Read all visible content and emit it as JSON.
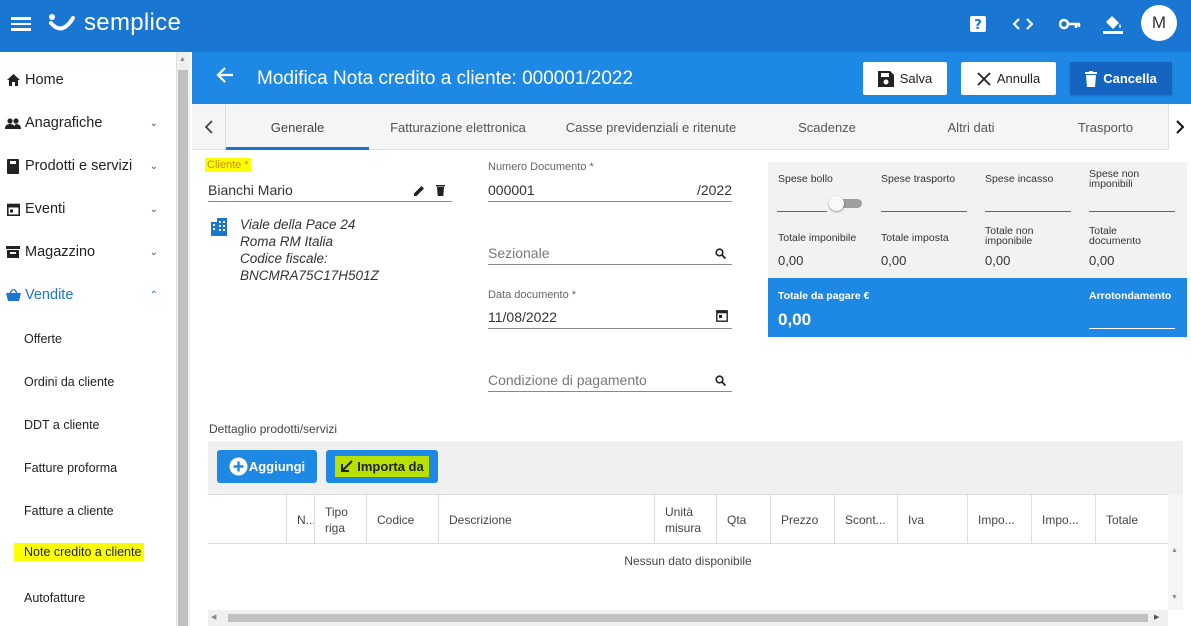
{
  "app": {
    "logo_text": "semplice",
    "avatar_initial": "M"
  },
  "topbar": {
    "icons": [
      "help-icon",
      "code-icon",
      "key-icon",
      "paint-bucket-icon"
    ]
  },
  "sidebar": {
    "items": [
      {
        "label": "Home",
        "icon": "home-icon"
      },
      {
        "label": "Anagrafiche",
        "icon": "people-icon"
      },
      {
        "label": "Prodotti e servizi",
        "icon": "book-icon"
      },
      {
        "label": "Eventi",
        "icon": "calendar-icon"
      },
      {
        "label": "Magazzino",
        "icon": "warehouse-icon"
      },
      {
        "label": "Vendite",
        "icon": "basket-icon"
      }
    ],
    "sub_items": [
      "Offerte",
      "Ordini da cliente",
      "DDT a cliente",
      "Fatture proforma",
      "Fatture a cliente",
      "Note credito a cliente",
      "Autofatture"
    ]
  },
  "header": {
    "title": "Modifica Nota credito a cliente: 000001/2022",
    "save_label": "Salva",
    "cancel_label": "Annulla",
    "delete_label": "Cancella"
  },
  "tabs": [
    "Generale",
    "Fatturazione elettronica",
    "Casse previdenziali e ritenute",
    "Scadenze",
    "Altri dati",
    "Trasporto"
  ],
  "form": {
    "cliente_label": "Cliente *",
    "cliente_value": "Bianchi Mario",
    "address_line1": "Viale della Pace 24",
    "address_line2": "Roma RM Italia",
    "address_line3": "Codice fiscale:",
    "address_line4": "BNCMRA75C17H501Z",
    "numero_label": "Numero Documento *",
    "numero_value": "000001",
    "numero_suffix": "/2022",
    "sezionale_placeholder": "Sezionale",
    "data_label": "Data documento *",
    "data_value": "11/08/2022",
    "condizione_placeholder": "Condizione di pagamento"
  },
  "totals": {
    "spese_bollo": "Spese bollo",
    "spese_trasporto": "Spese trasporto",
    "spese_incasso": "Spese incasso",
    "spese_non_imponibili": "Spese non imponibili",
    "totale_imponibile": "Totale imponibile",
    "totale_imposta": "Totale imposta",
    "totale_non_imponibile": "Totale non imponibile",
    "totale_documento": "Totale documento",
    "val_imponibile": "0,00",
    "val_imposta": "0,00",
    "val_non_imponibile": "0,00",
    "val_documento": "0,00",
    "totale_da_pagare_label": "Totale da pagare €",
    "totale_da_pagare_value": "0,00",
    "arrotondamento_label": "Arrotondamento"
  },
  "detail": {
    "title": "Dettaglio prodotti/servizi",
    "add_label": "Aggiungi",
    "import_label": "Importa da",
    "columns": [
      "N...",
      "Tipo riga",
      "Codice",
      "Descrizione",
      "Unità misura",
      "Qta",
      "Prezzo",
      "Scont...",
      "Iva",
      "Impo...",
      "Impo...",
      "Totale"
    ],
    "empty_text": "Nessun dato disponibile"
  },
  "colors": {
    "primary": "#1976d2",
    "header": "#1e88e5",
    "highlight": "#fbff00"
  }
}
